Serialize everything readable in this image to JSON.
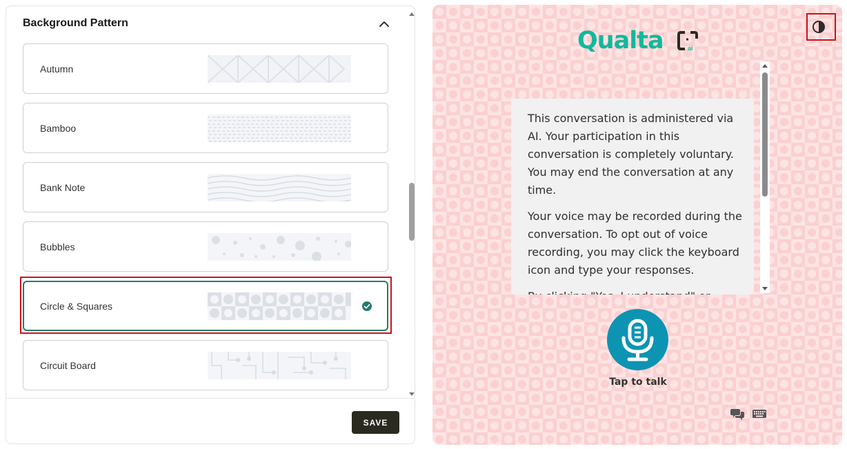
{
  "settings_panel": {
    "title": "Background Pattern",
    "collapse_icon": "chevron-up-icon",
    "patterns": [
      {
        "label": "Autumn",
        "preview": "chevron-pattern",
        "selected": false
      },
      {
        "label": "Bamboo",
        "preview": "dash-pattern",
        "selected": false
      },
      {
        "label": "Bank Note",
        "preview": "wave-pattern",
        "selected": false
      },
      {
        "label": "Bubbles",
        "preview": "bubble-pattern",
        "selected": false
      },
      {
        "label": "Circle & Squares",
        "preview": "circle-square-pattern",
        "selected": true
      },
      {
        "label": "Circuit Board",
        "preview": "circuit-pattern",
        "selected": false
      }
    ],
    "save_label": "SAVE"
  },
  "preview": {
    "logo_text": "Qualta",
    "logo_suffix": "ai",
    "theme_toggle_icon": "contrast-icon",
    "messages": [
      "This conversation is administered via AI. Your participation in this conversation is completely voluntary. You may end the conversation at any time.",
      "Your voice may be recorded during the conversation. To opt out of voice recording, you may click the keyboard icon and type your responses.",
      "By clicking \"Yes, I understand\" or continuing with the interview..."
    ],
    "mic_icon": "microphone-icon",
    "tap_label": "Tap to talk",
    "chat_icon": "chat-bubbles-icon",
    "keyboard_icon": "keyboard-icon"
  },
  "colors": {
    "accent": "#1e7d6b",
    "highlight": "#d0101a",
    "brand": "#12b89c",
    "mic": "#0d94b3",
    "preview_bg": "#fde4e4"
  }
}
